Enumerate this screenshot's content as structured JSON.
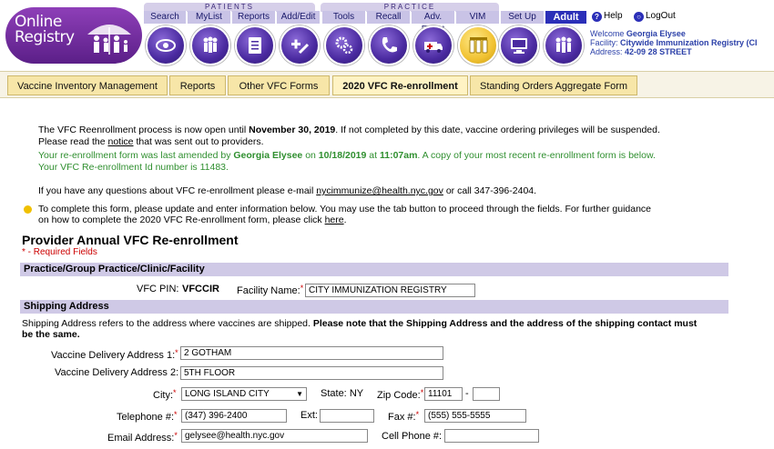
{
  "header": {
    "logo_line1": "Online",
    "logo_line2": "Registry",
    "group_patients": "PATIENTS",
    "group_practice": "PRACTICE",
    "tabs": [
      {
        "label": "Search"
      },
      {
        "label": "MyList"
      },
      {
        "label": "Reports"
      },
      {
        "label": "Add/Edit"
      },
      {
        "label": "Tools"
      },
      {
        "label": "Recall"
      },
      {
        "label": "Adv. Event"
      },
      {
        "label": "VIM"
      },
      {
        "label": "Set Up"
      },
      {
        "label": "Adult"
      }
    ],
    "help_label": "Help",
    "logout_label": "LogOut",
    "welcome_prefix": "Welcome",
    "welcome_name": "Georgia Elysee",
    "facility_prefix": "Facility:",
    "facility_name": "Citywide Immunization Registry (CI",
    "address_prefix": "Address:",
    "address_value": "42-09 28 STREET"
  },
  "subtabs": [
    {
      "label": "Vaccine Inventory Management"
    },
    {
      "label": "Reports"
    },
    {
      "label": "Other VFC Forms"
    },
    {
      "label": "2020 VFC Re-enrollment"
    },
    {
      "label": "Standing Orders Aggregate Form"
    }
  ],
  "info": {
    "line1_a": "The VFC Reenrollment process is now open until",
    "line1_b": "November 30, 2019",
    "line1_c": ". If not completed by this date, vaccine ordering privileges will be suspended.",
    "line2_a": "Please read the",
    "line2_link": "notice",
    "line2_c": "that was sent out to providers.",
    "line3_a": "Your re-enrollment form was last amended by",
    "line3_b": "Georgia Elysee",
    "line3_c": "on",
    "line3_d": "10/18/2019",
    "line3_e": "at",
    "line3_f": "11:07am",
    "line3_g": ". A copy of your most recent re-enrollment form is below.",
    "line4": "Your VFC Re-enrollment Id number is 11483.",
    "line5_a": "If you have any questions about VFC re-enrollment please e-mail",
    "line5_link": "nycimmunize@health.nyc.gov",
    "line5_c": "or call 347-396-2404.",
    "line6": "To complete this form, please update and enter information below. You may use the tab button to proceed through the fields. For further guidance",
    "line7_a": "on how to complete the 2020 VFC Re-enrollment form, please click",
    "line7_link": "here",
    "line7_c": "."
  },
  "form": {
    "title": "Provider Annual VFC Re-enrollment",
    "required_note": "* - Required Fields",
    "section_practice": "Practice/Group Practice/Clinic/Facility",
    "vfc_pin_label": "VFC PIN:",
    "vfc_pin_value": "VFCCIR",
    "facility_name_label": "Facility Name:",
    "facility_name_value": "CITY IMMUNIZATION REGISTRY",
    "section_shipping": "Shipping Address",
    "shipping_note_a": "Shipping Address refers to the address where vaccines are shipped.",
    "shipping_note_b": "Please note that the Shipping Address and the address of the shipping contact must",
    "shipping_note_c": "be the same.",
    "addr1_label": "Vaccine Delivery Address 1:",
    "addr1_value": "2 GOTHAM",
    "addr2_label": "Vaccine Delivery Address 2:",
    "addr2_value": "5TH FLOOR",
    "city_label": "City:",
    "city_value": "LONG ISLAND CITY",
    "state_label": "State:",
    "state_value": "NY",
    "zip_label": "Zip Code:",
    "zip_value": "11101",
    "zip_sep": "-",
    "zip_ext_value": "",
    "tel_label": "Telephone #:",
    "tel_value": "(347) 396-2400",
    "ext_label": "Ext:",
    "ext_value": "",
    "fax_label": "Fax #:",
    "fax_value": "(555) 555-5555",
    "email_label": "Email Address:",
    "email_value": "gelysee@health.nyc.gov",
    "cell_label": "Cell Phone #:",
    "cell_value": ""
  },
  "colors": {
    "brand_purple": "#5b1f88",
    "nav_blue": "#2b2fb8",
    "section_bar": "#cfc9e6",
    "subtab_bg": "#f7e6a8",
    "green_text": "#2f8f2f",
    "required_red": "#cc0000"
  }
}
